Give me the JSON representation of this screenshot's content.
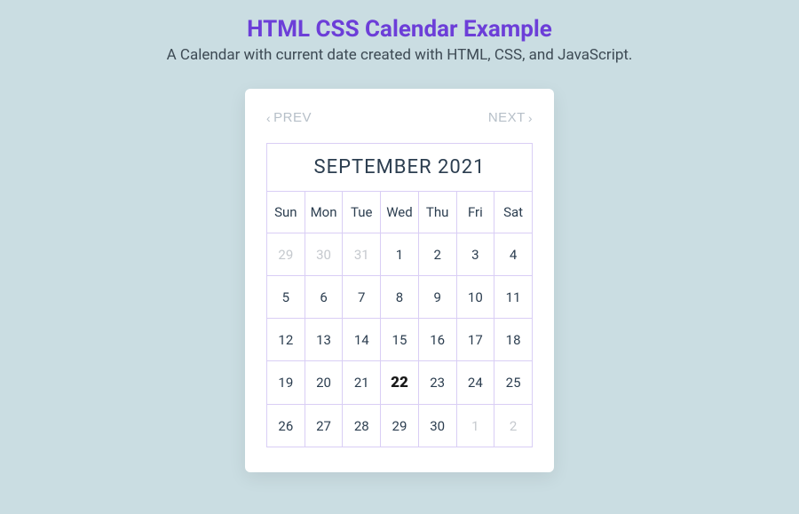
{
  "header": {
    "title": "HTML CSS Calendar Example",
    "subtitle": "A Calendar with current date created with HTML, CSS, and JavaScript."
  },
  "nav": {
    "prev": "PREV",
    "next": "NEXT"
  },
  "calendar": {
    "month_year": "SEPTEMBER 2021",
    "weekdays": [
      "Sun",
      "Mon",
      "Tue",
      "Wed",
      "Thu",
      "Fri",
      "Sat"
    ],
    "weeks": [
      [
        {
          "day": "29",
          "other": true,
          "today": false
        },
        {
          "day": "30",
          "other": true,
          "today": false
        },
        {
          "day": "31",
          "other": true,
          "today": false
        },
        {
          "day": "1",
          "other": false,
          "today": false
        },
        {
          "day": "2",
          "other": false,
          "today": false
        },
        {
          "day": "3",
          "other": false,
          "today": false
        },
        {
          "day": "4",
          "other": false,
          "today": false
        }
      ],
      [
        {
          "day": "5",
          "other": false,
          "today": false
        },
        {
          "day": "6",
          "other": false,
          "today": false
        },
        {
          "day": "7",
          "other": false,
          "today": false
        },
        {
          "day": "8",
          "other": false,
          "today": false
        },
        {
          "day": "9",
          "other": false,
          "today": false
        },
        {
          "day": "10",
          "other": false,
          "today": false
        },
        {
          "day": "11",
          "other": false,
          "today": false
        }
      ],
      [
        {
          "day": "12",
          "other": false,
          "today": false
        },
        {
          "day": "13",
          "other": false,
          "today": false
        },
        {
          "day": "14",
          "other": false,
          "today": false
        },
        {
          "day": "15",
          "other": false,
          "today": false
        },
        {
          "day": "16",
          "other": false,
          "today": false
        },
        {
          "day": "17",
          "other": false,
          "today": false
        },
        {
          "day": "18",
          "other": false,
          "today": false
        }
      ],
      [
        {
          "day": "19",
          "other": false,
          "today": false
        },
        {
          "day": "20",
          "other": false,
          "today": false
        },
        {
          "day": "21",
          "other": false,
          "today": false
        },
        {
          "day": "22",
          "other": false,
          "today": true
        },
        {
          "day": "23",
          "other": false,
          "today": false
        },
        {
          "day": "24",
          "other": false,
          "today": false
        },
        {
          "day": "25",
          "other": false,
          "today": false
        }
      ],
      [
        {
          "day": "26",
          "other": false,
          "today": false
        },
        {
          "day": "27",
          "other": false,
          "today": false
        },
        {
          "day": "28",
          "other": false,
          "today": false
        },
        {
          "day": "29",
          "other": false,
          "today": false
        },
        {
          "day": "30",
          "other": false,
          "today": false
        },
        {
          "day": "1",
          "other": true,
          "today": false
        },
        {
          "day": "2",
          "other": true,
          "today": false
        }
      ]
    ]
  }
}
